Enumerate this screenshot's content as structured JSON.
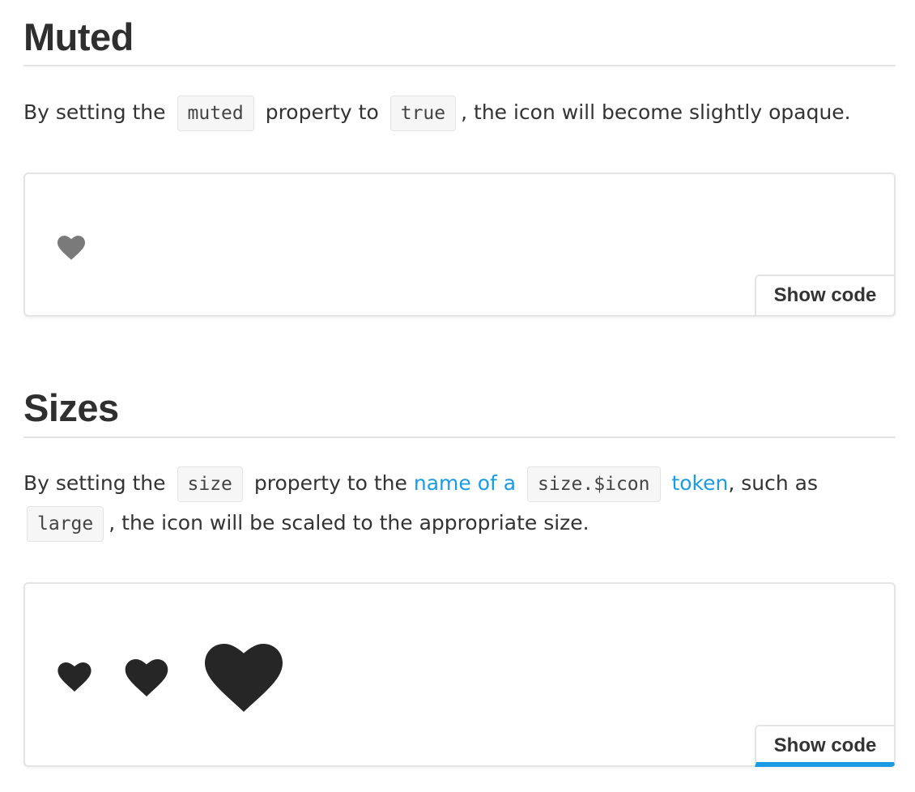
{
  "muted": {
    "title": "Muted",
    "para": {
      "t1": "By setting the",
      "code1": "muted",
      "t2": "property to",
      "code2": "true",
      "t3": ", the icon will become slightly opaque."
    },
    "icon": "heart-icon",
    "icon_color": "#7a7a7a",
    "show_code_label": "Show code"
  },
  "sizes": {
    "title": "Sizes",
    "para": {
      "t1": "By setting the",
      "code1": "size",
      "t2": "property to the",
      "link1": "name of a",
      "code2": "size.$icon",
      "link2": "token",
      "t3": ", such as",
      "code3": "large",
      "t4": ", the icon will be scaled to the appropriate size."
    },
    "icons": [
      "heart-icon-small",
      "heart-icon-medium",
      "heart-icon-large"
    ],
    "icon_color": "#262626",
    "show_code_label": "Show code"
  },
  "colors": {
    "link": "#1a9be4",
    "active_tab_underline": "#1a9be4"
  }
}
